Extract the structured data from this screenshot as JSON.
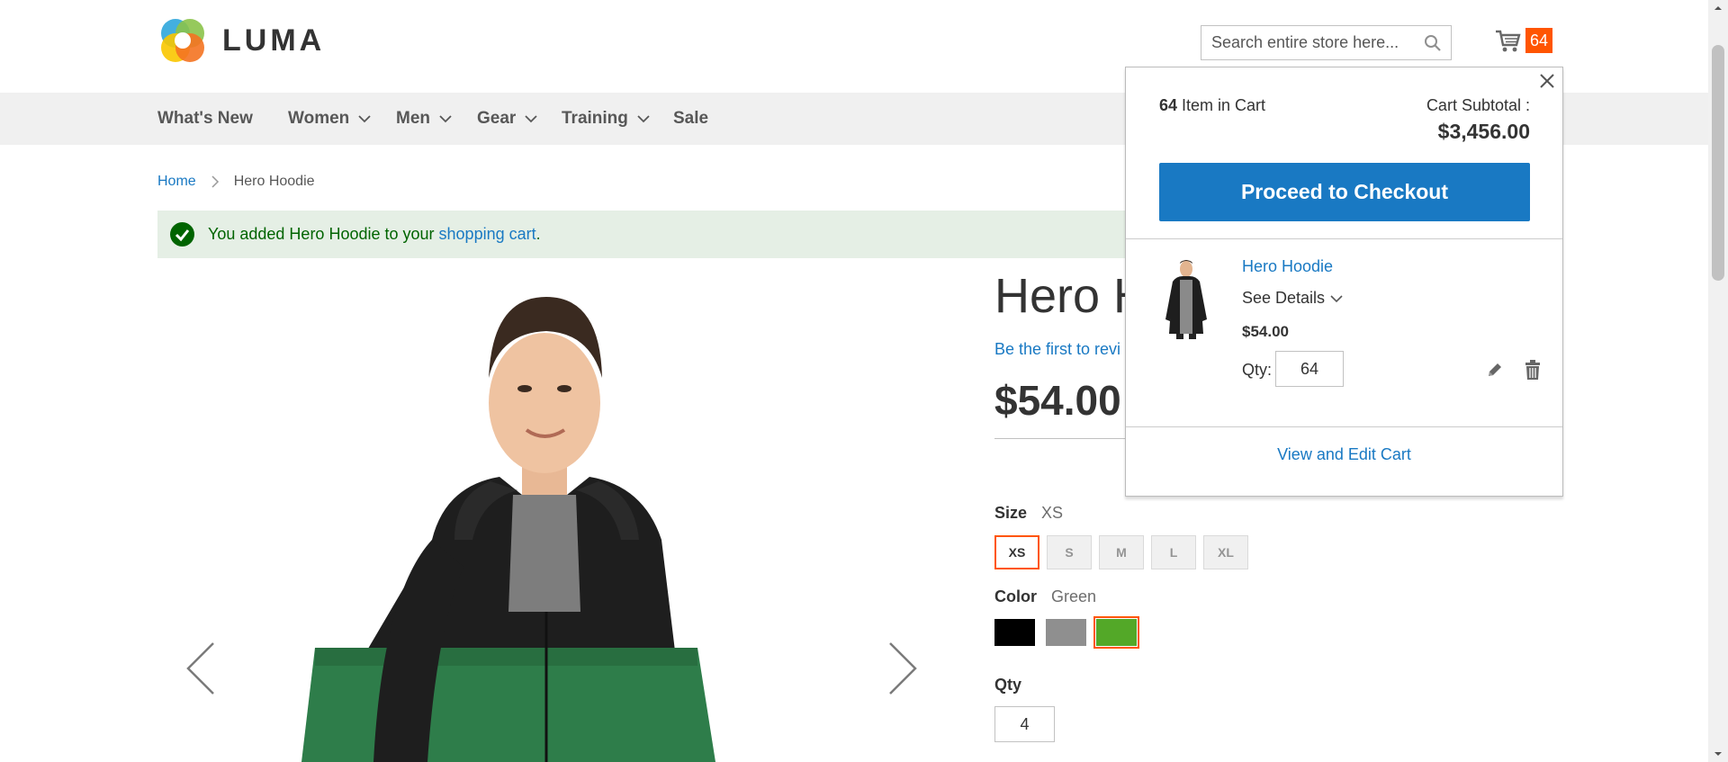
{
  "header": {
    "logo_text": "LUMA",
    "search_placeholder": "Search entire store here...",
    "cart_count": "64"
  },
  "nav": {
    "items": [
      {
        "label": "What's New"
      },
      {
        "label": "Women"
      },
      {
        "label": "Men"
      },
      {
        "label": "Gear"
      },
      {
        "label": "Training"
      },
      {
        "label": "Sale"
      }
    ]
  },
  "breadcrumb": {
    "home": "Home",
    "current": "Hero Hoodie"
  },
  "message": {
    "prefix": "You added Hero Hoodie to your ",
    "link": "shopping cart",
    "suffix": "."
  },
  "product": {
    "title": "Hero H",
    "review_link": "Be the first to revi",
    "price": "$54.00",
    "size_label": "Size",
    "size_value": "XS",
    "sizes": [
      "XS",
      "S",
      "M",
      "L",
      "XL"
    ],
    "color_label": "Color",
    "color_value": "Green",
    "colors": [
      "#000000",
      "#8f8f8f",
      "#53a828"
    ],
    "qty_label": "Qty",
    "qty_value": "4"
  },
  "minicart": {
    "count": "64",
    "count_suffix": " Item in Cart",
    "subtotal_label": "Cart Subtotal :",
    "subtotal": "$3,456.00",
    "checkout_label": "Proceed to Checkout",
    "item": {
      "name": "Hero Hoodie",
      "details": "See Details",
      "price": "$54.00",
      "qty_label": "Qty:",
      "qty": "64"
    },
    "view_edit": "View and Edit Cart"
  },
  "colors": {
    "accent": "#ff5501",
    "link": "#1979c3",
    "button": "#1979c3",
    "success_bg": "#e5efe5",
    "success_text": "#006400"
  }
}
